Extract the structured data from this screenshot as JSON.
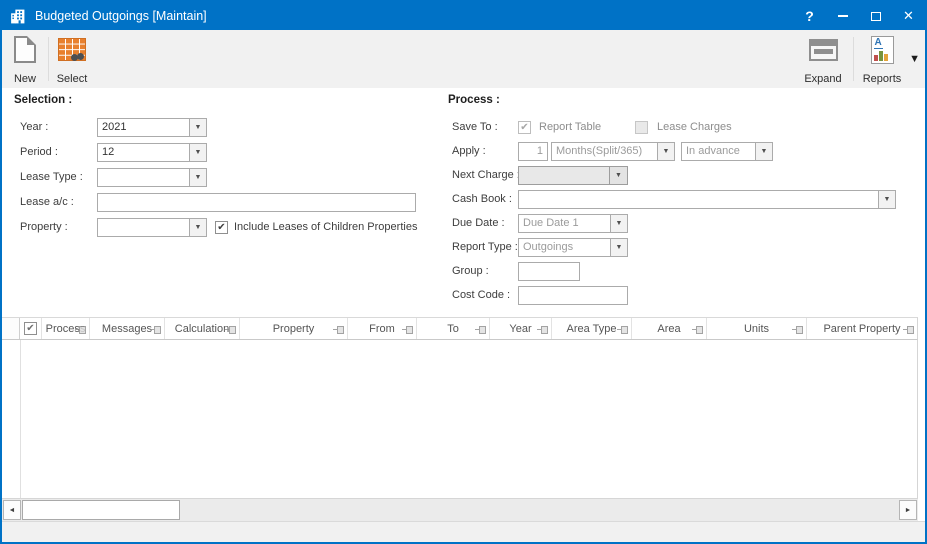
{
  "window": {
    "title": "Budgeted Outgoings [Maintain]",
    "help_glyph": "?",
    "close_glyph": "✕"
  },
  "toolbar": {
    "new_label": "New",
    "select_label": "Select",
    "expand_label": "Expand",
    "reports_label": "Reports",
    "reports_letter": "A"
  },
  "selection": {
    "header": "Selection :",
    "year_label": "Year :",
    "year_value": "2021",
    "period_label": "Period :",
    "period_value": "12",
    "lease_type_label": "Lease Type :",
    "lease_type_value": "",
    "lease_ac_label": "Lease a/c :",
    "lease_ac_value": "",
    "property_label": "Property :",
    "property_value": "",
    "include_children_label": "Include Leases of Children Properties",
    "include_children_check": "✔"
  },
  "process": {
    "header": "Process :",
    "save_to_label": "Save To :",
    "report_table_label": "Report Table",
    "report_table_check": "✔",
    "lease_charges_label": "Lease Charges",
    "apply_label": "Apply :",
    "apply_count": "1",
    "apply_unit": "Months(Split/365)",
    "apply_timing": "In advance",
    "next_charge_label": "Next Charge :",
    "next_charge_value": "",
    "cash_book_label": "Cash Book :",
    "cash_book_value": "",
    "due_date_label": "Due Date :",
    "due_date_value": "Due Date 1",
    "report_type_label": "Report Type :",
    "report_type_value": "Outgoings",
    "group_label": "Group :",
    "group_value": "",
    "cost_code_label": "Cost Code :",
    "cost_code_value": ""
  },
  "grid": {
    "header_check": "✔",
    "columns": [
      "Process",
      "Messages",
      "Calculation",
      "Property",
      "From",
      "To",
      "Year",
      "Area Type",
      "Area",
      "Units",
      "Parent Property"
    ]
  },
  "colors": {
    "titlebar_blue": "#0072C6",
    "select_icon_orange": "#E8802E",
    "reports_letter_blue": "#2E74B5"
  }
}
